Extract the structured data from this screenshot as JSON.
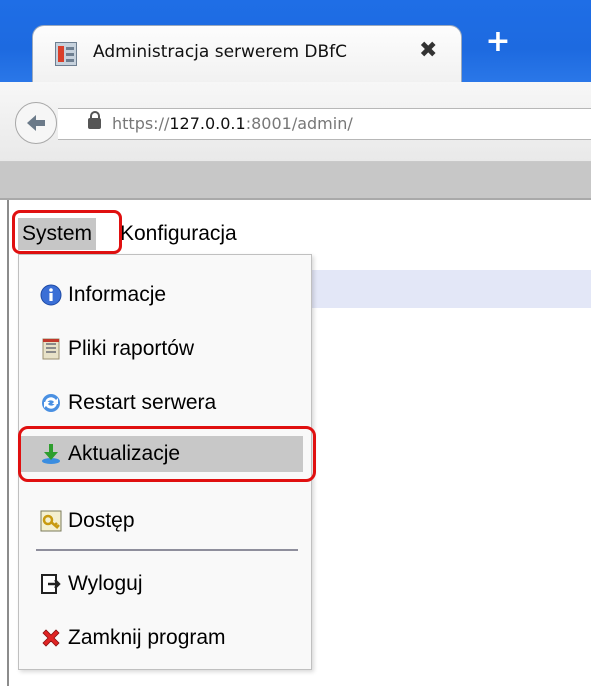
{
  "browser": {
    "tab": {
      "title": "Administracja serwerem DBfC",
      "close": "✖"
    },
    "new_tab": "+",
    "address": {
      "scheme": "https://",
      "host": "127.0.0.1",
      "port_path": ":8001/admin/"
    }
  },
  "menubar": {
    "items": [
      {
        "label": "System",
        "state": "open"
      },
      {
        "label": "Konfiguracja"
      }
    ]
  },
  "dropdown": {
    "items": [
      {
        "label": "Informacje",
        "icon": "info-icon"
      },
      {
        "label": "Pliki raportów",
        "icon": "report-files-icon"
      },
      {
        "label": "Restart serwera",
        "icon": "restart-icon"
      },
      {
        "label": "Aktualizacje",
        "icon": "download-update-icon",
        "highlighted": true
      },
      {
        "label": "Dostęp",
        "icon": "key-icon"
      },
      {
        "label": "Wyloguj",
        "icon": "logout-icon"
      },
      {
        "label": "Zamknij program",
        "icon": "close-program-icon"
      }
    ]
  },
  "colors": {
    "titlebar": "#1f6ee6",
    "highlight_outline": "#e01010",
    "menu_selected": "#c6c6c6"
  }
}
